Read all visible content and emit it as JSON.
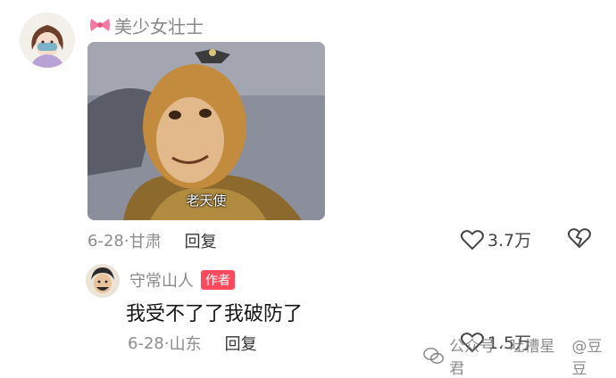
{
  "comment": {
    "username": "美少女壮士",
    "image_caption": "老天使",
    "date": "6-28·",
    "location": "甘肃",
    "reply_label": "回复",
    "like_count": "3.7万"
  },
  "reply": {
    "username": "守常山人",
    "badge": "作者",
    "text": "我受不了了我破防了",
    "date": "6-28·",
    "location": "山东",
    "reply_label": "回复",
    "like_count": "1.5万"
  },
  "watermark": {
    "left_text": "公众号 · 吐槽星君",
    "right_text": "@豆豆"
  },
  "icons": {
    "heart": "heart-icon",
    "broken_heart": "broken-heart-icon",
    "bow": "bow-icon",
    "wechat": "wechat-icon"
  },
  "colors": {
    "author_badge": "#ff4a5e",
    "bow": "#f27aa0",
    "meta_text": "#8d8d8d"
  }
}
